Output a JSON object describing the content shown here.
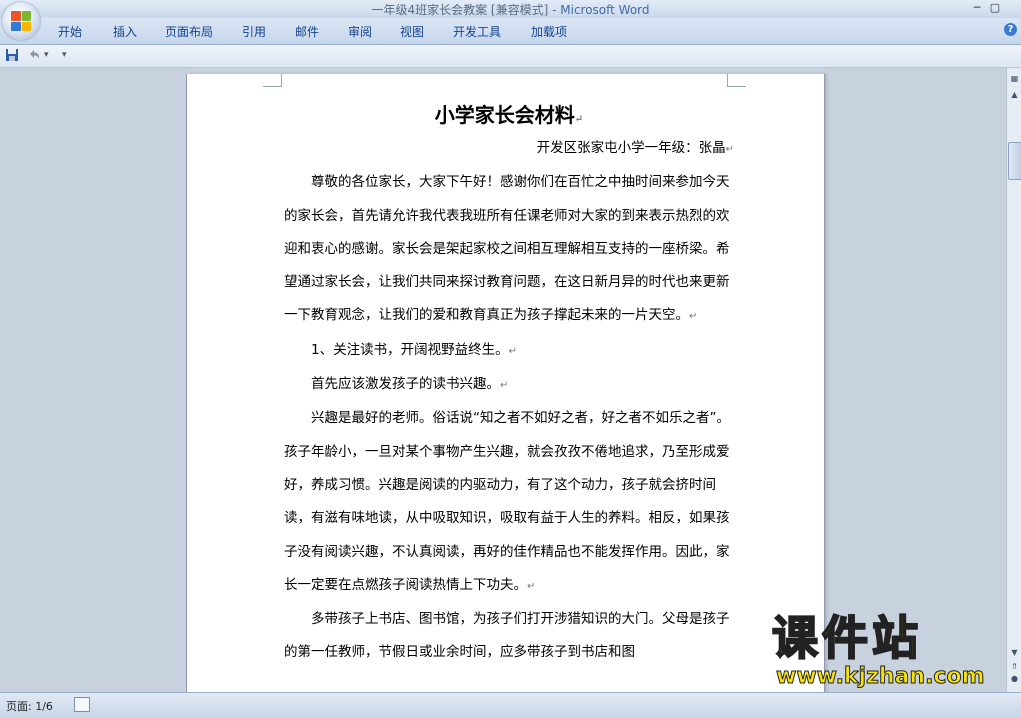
{
  "window": {
    "title_doc": "一年级4班家长会教案 [兼容模式] - ",
    "title_app": "Microsoft Word",
    "minimize": "─",
    "maximize": "▢"
  },
  "ribbon": {
    "tabs": [
      "开始",
      "插入",
      "页面布局",
      "引用",
      "邮件",
      "审阅",
      "视图",
      "开发工具",
      "加载项"
    ],
    "help": "?"
  },
  "qat": {
    "save_icon": "save-icon",
    "undo_icon": "undo-icon",
    "dropdown": "▾"
  },
  "document": {
    "title": "小学家长会材料",
    "author_line": "开发区张家屯小学一年级：张晶",
    "paragraphs": [
      "尊敬的各位家长，大家下午好！感谢你们在百忙之中抽时间来参加今天的家长会，首先请允许我代表我班所有任课老师对大家的到来表示热烈的欢迎和衷心的感谢。家长会是架起家校之间相互理解相互支持的一座桥梁。希望通过家长会，让我们共同来探讨教育问题，在这日新月异的时代也来更新一下教育观念，让我们的爱和教育真正为孩子撑起未来的一片天空。",
      "1、关注读书，开阔视野益终生。",
      "首先应该激发孩子的读书兴趣。",
      "兴趣是最好的老师。俗话说“知之者不如好之者，好之者不如乐之者”。孩子年龄小，一旦对某个事物产生兴趣，就会孜孜不倦地追求，乃至形成爱好，养成习惯。兴趣是阅读的内驱动力，有了这个动力，孩子就会挤时间读，有滋有味地读，从中吸取知识，吸取有益于人生的养料。相反，如果孩子没有阅读兴趣，不认真阅读，再好的佳作精品也不能发挥作用。因此，家长一定要在点燃孩子阅读热情上下功夫。",
      "多带孩子上书店、图书馆，为孩子们打开涉猎知识的大门。父母是孩子的第一任教师，节假日或业余时间，应多带孩子到书店和图"
    ],
    "mark": "↵"
  },
  "status": {
    "page": "页面: 1/6"
  },
  "watermark": {
    "main": "课件站",
    "sub": "www.kjzhan.com"
  },
  "colors": {
    "ribbon_text": "#15428b",
    "watermark": "#f8e400"
  }
}
